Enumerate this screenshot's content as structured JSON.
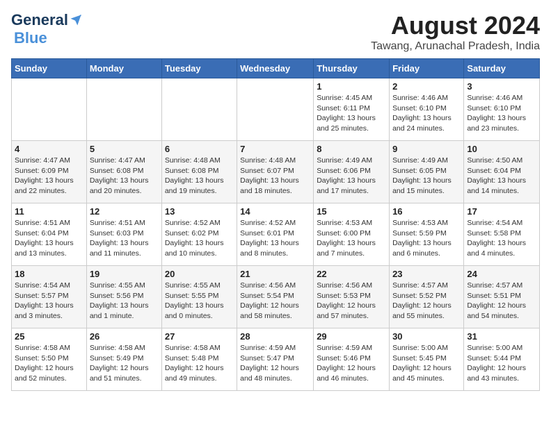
{
  "logo": {
    "general": "General",
    "blue": "Blue"
  },
  "title": {
    "month_year": "August 2024",
    "location": "Tawang, Arunachal Pradesh, India"
  },
  "days_of_week": [
    "Sunday",
    "Monday",
    "Tuesday",
    "Wednesday",
    "Thursday",
    "Friday",
    "Saturday"
  ],
  "weeks": [
    [
      {
        "day": "",
        "info": ""
      },
      {
        "day": "",
        "info": ""
      },
      {
        "day": "",
        "info": ""
      },
      {
        "day": "",
        "info": ""
      },
      {
        "day": "1",
        "info": "Sunrise: 4:45 AM\nSunset: 6:11 PM\nDaylight: 13 hours\nand 25 minutes."
      },
      {
        "day": "2",
        "info": "Sunrise: 4:46 AM\nSunset: 6:10 PM\nDaylight: 13 hours\nand 24 minutes."
      },
      {
        "day": "3",
        "info": "Sunrise: 4:46 AM\nSunset: 6:10 PM\nDaylight: 13 hours\nand 23 minutes."
      }
    ],
    [
      {
        "day": "4",
        "info": "Sunrise: 4:47 AM\nSunset: 6:09 PM\nDaylight: 13 hours\nand 22 minutes."
      },
      {
        "day": "5",
        "info": "Sunrise: 4:47 AM\nSunset: 6:08 PM\nDaylight: 13 hours\nand 20 minutes."
      },
      {
        "day": "6",
        "info": "Sunrise: 4:48 AM\nSunset: 6:08 PM\nDaylight: 13 hours\nand 19 minutes."
      },
      {
        "day": "7",
        "info": "Sunrise: 4:48 AM\nSunset: 6:07 PM\nDaylight: 13 hours\nand 18 minutes."
      },
      {
        "day": "8",
        "info": "Sunrise: 4:49 AM\nSunset: 6:06 PM\nDaylight: 13 hours\nand 17 minutes."
      },
      {
        "day": "9",
        "info": "Sunrise: 4:49 AM\nSunset: 6:05 PM\nDaylight: 13 hours\nand 15 minutes."
      },
      {
        "day": "10",
        "info": "Sunrise: 4:50 AM\nSunset: 6:04 PM\nDaylight: 13 hours\nand 14 minutes."
      }
    ],
    [
      {
        "day": "11",
        "info": "Sunrise: 4:51 AM\nSunset: 6:04 PM\nDaylight: 13 hours\nand 13 minutes."
      },
      {
        "day": "12",
        "info": "Sunrise: 4:51 AM\nSunset: 6:03 PM\nDaylight: 13 hours\nand 11 minutes."
      },
      {
        "day": "13",
        "info": "Sunrise: 4:52 AM\nSunset: 6:02 PM\nDaylight: 13 hours\nand 10 minutes."
      },
      {
        "day": "14",
        "info": "Sunrise: 4:52 AM\nSunset: 6:01 PM\nDaylight: 13 hours\nand 8 minutes."
      },
      {
        "day": "15",
        "info": "Sunrise: 4:53 AM\nSunset: 6:00 PM\nDaylight: 13 hours\nand 7 minutes."
      },
      {
        "day": "16",
        "info": "Sunrise: 4:53 AM\nSunset: 5:59 PM\nDaylight: 13 hours\nand 6 minutes."
      },
      {
        "day": "17",
        "info": "Sunrise: 4:54 AM\nSunset: 5:58 PM\nDaylight: 13 hours\nand 4 minutes."
      }
    ],
    [
      {
        "day": "18",
        "info": "Sunrise: 4:54 AM\nSunset: 5:57 PM\nDaylight: 13 hours\nand 3 minutes."
      },
      {
        "day": "19",
        "info": "Sunrise: 4:55 AM\nSunset: 5:56 PM\nDaylight: 13 hours\nand 1 minute."
      },
      {
        "day": "20",
        "info": "Sunrise: 4:55 AM\nSunset: 5:55 PM\nDaylight: 13 hours\nand 0 minutes."
      },
      {
        "day": "21",
        "info": "Sunrise: 4:56 AM\nSunset: 5:54 PM\nDaylight: 12 hours\nand 58 minutes."
      },
      {
        "day": "22",
        "info": "Sunrise: 4:56 AM\nSunset: 5:53 PM\nDaylight: 12 hours\nand 57 minutes."
      },
      {
        "day": "23",
        "info": "Sunrise: 4:57 AM\nSunset: 5:52 PM\nDaylight: 12 hours\nand 55 minutes."
      },
      {
        "day": "24",
        "info": "Sunrise: 4:57 AM\nSunset: 5:51 PM\nDaylight: 12 hours\nand 54 minutes."
      }
    ],
    [
      {
        "day": "25",
        "info": "Sunrise: 4:58 AM\nSunset: 5:50 PM\nDaylight: 12 hours\nand 52 minutes."
      },
      {
        "day": "26",
        "info": "Sunrise: 4:58 AM\nSunset: 5:49 PM\nDaylight: 12 hours\nand 51 minutes."
      },
      {
        "day": "27",
        "info": "Sunrise: 4:58 AM\nSunset: 5:48 PM\nDaylight: 12 hours\nand 49 minutes."
      },
      {
        "day": "28",
        "info": "Sunrise: 4:59 AM\nSunset: 5:47 PM\nDaylight: 12 hours\nand 48 minutes."
      },
      {
        "day": "29",
        "info": "Sunrise: 4:59 AM\nSunset: 5:46 PM\nDaylight: 12 hours\nand 46 minutes."
      },
      {
        "day": "30",
        "info": "Sunrise: 5:00 AM\nSunset: 5:45 PM\nDaylight: 12 hours\nand 45 minutes."
      },
      {
        "day": "31",
        "info": "Sunrise: 5:00 AM\nSunset: 5:44 PM\nDaylight: 12 hours\nand 43 minutes."
      }
    ]
  ]
}
